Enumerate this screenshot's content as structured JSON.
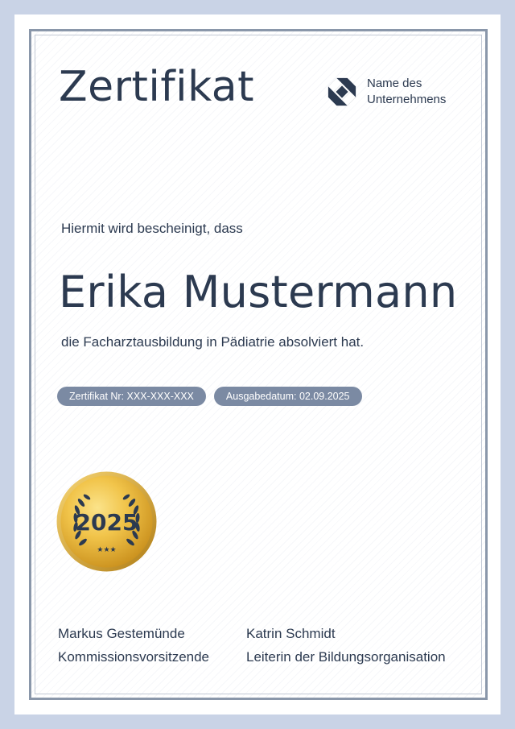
{
  "certificate": {
    "title": "Zertifikat",
    "company_name": "Name des\nUnternehmens",
    "intro": "Hiermit wird bescheinigt, dass",
    "recipient": "Erika Mustermann",
    "statement": "die Facharztausbildung in Pädiatrie absolviert hat.",
    "number_label": "Zertifikat Nr: XXX-XXX-XXX",
    "date_label": "Ausgabedatum: 02.09.2025",
    "seal_year": "2025",
    "seal_icon": "gold-laurel-seal",
    "company_logo_icon": "geometric-logo-icon"
  },
  "signatures": [
    {
      "name": "Markus Gestemünde",
      "role": "Kommissionsvorsitzende"
    },
    {
      "name": "Katrin Schmidt",
      "role": "Leiterin der Bildungsorganisation"
    }
  ],
  "colors": {
    "text": "#2c3a50",
    "chip": "#7b8aa3",
    "outer_border": "#c9d3e6",
    "frame": "#8a97aa",
    "gold": "#d9a72a"
  }
}
